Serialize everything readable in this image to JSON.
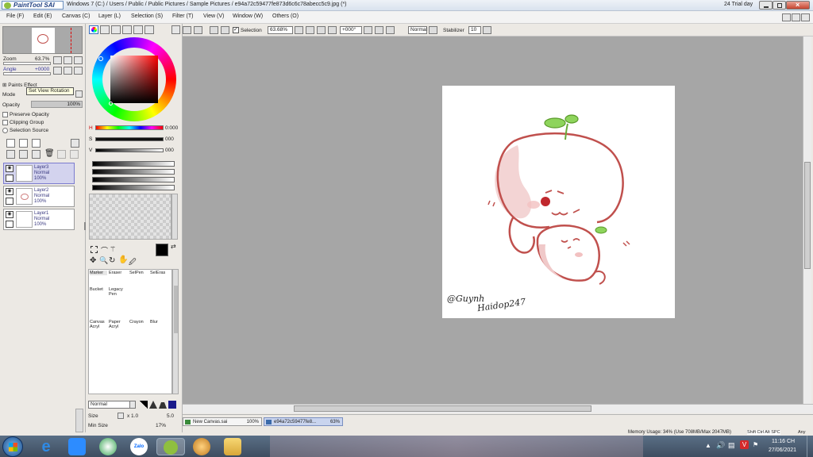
{
  "window": {
    "app_name": "PaintTool SAI",
    "path": "Windows 7 (C:) / Users / Public / Public Pictures / Sample Pictures / e94a72c59477fe873d6c6c78abecc5c9.jpg (*)",
    "trial": "24 Trial day"
  },
  "menu": [
    "File (F)",
    "Edit (E)",
    "Canvas (C)",
    "Layer (L)",
    "Selection (S)",
    "Filter (T)",
    "View (V)",
    "Window (W)",
    "Others (O)"
  ],
  "toolbar": {
    "selection_label": "Selection",
    "zoom_value": "63.68%",
    "rotation_value": "+000°",
    "blend_mode": "Normal",
    "stabilizer_label": "Stabilizer",
    "stabilizer_value": "10"
  },
  "navigator": {
    "zoom_label": "Zoom",
    "zoom_value": "63.7%",
    "angle_label": "Angle",
    "angle_value": "+0000",
    "tooltip": "Set View Rotation",
    "paints_effect": "Paints Effect"
  },
  "layer_props": {
    "mode_label": "Mode",
    "opacity_label": "Opacity",
    "opacity_value": "100%",
    "preserve_opacity": "Preserve Opacity",
    "clipping_group": "Clipping Group",
    "selection_source": "Selection Source"
  },
  "layers": [
    {
      "name": "Layer3",
      "mode": "Normal",
      "opacity": "100%",
      "selected": true
    },
    {
      "name": "Layer2",
      "mode": "Normal",
      "opacity": "100%",
      "selected": false
    },
    {
      "name": "Layer1",
      "mode": "Normal",
      "opacity": "100%",
      "selected": false
    }
  ],
  "color": {
    "h_label": "H",
    "h_value": "0:000",
    "s_label": "S",
    "s_value": "000",
    "v_label": "V",
    "v_value": "000"
  },
  "tools": [
    {
      "name": "Marker"
    },
    {
      "name": "Eraser"
    },
    {
      "name": "SelPen"
    },
    {
      "name": "SelEras"
    },
    {
      "name": "Bucket"
    },
    {
      "name": "Legacy Pen"
    },
    {
      "name": "Canvas Acryl"
    },
    {
      "name": "Paper Acryl"
    },
    {
      "name": "Crayon"
    },
    {
      "name": "Blur"
    }
  ],
  "brush": {
    "mode": "Normal",
    "size_label": "Size",
    "size_multiplier": "x 1.0",
    "size_value": "5.0",
    "min_size_label": "Min Size",
    "min_size_value": "17%"
  },
  "documents": [
    {
      "name": "New Canvas.sai",
      "zoom": "100%"
    },
    {
      "name": "e94a72c59477fe8...",
      "zoom": "63%"
    }
  ],
  "status": {
    "memory": "Memory Usage: 34% (Use 708MB/Max 2047MB)",
    "keys": "Shift Ctrl Alt SPC",
    "any": "Any"
  },
  "artwork": {
    "signature_top": "@Guynh",
    "signature_bottom": "Haidop247"
  },
  "taskbar": {
    "time": "11:16 CH",
    "date": "27/06/2021",
    "zalo_label": "Zalo"
  }
}
